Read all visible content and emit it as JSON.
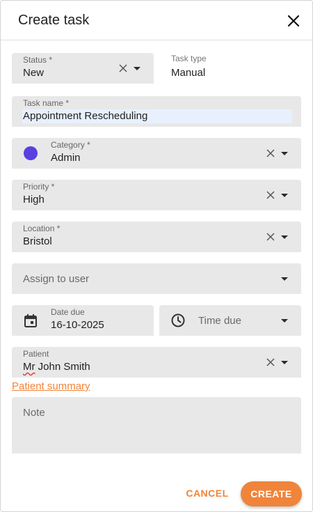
{
  "dialog": {
    "title": "Create task",
    "close_icon": "close-icon"
  },
  "status": {
    "label": "Status *",
    "value": "New"
  },
  "task_type": {
    "label": "Task type",
    "value": "Manual"
  },
  "task_name": {
    "label": "Task name *",
    "value": "Appointment Rescheduling"
  },
  "category": {
    "label": "Category *",
    "value": "Admin",
    "color": "#5b3fe0"
  },
  "priority": {
    "label": "Priority *",
    "value": "High"
  },
  "location": {
    "label": "Location *",
    "value": "Bristol"
  },
  "assign": {
    "placeholder": "Assign to user"
  },
  "date_due": {
    "label": "Date due",
    "value": "16-10-2025",
    "icon": "calendar-icon"
  },
  "time_due": {
    "placeholder": "Time due",
    "icon": "clock-icon"
  },
  "patient": {
    "label": "Patient",
    "title": "Mr",
    "name": "John Smith"
  },
  "patient_summary_link": "Patient summary",
  "note": {
    "placeholder": "Note"
  },
  "actions": {
    "cancel": "CANCEL",
    "create": "CREATE"
  },
  "colors": {
    "accent": "#f0843a",
    "field_bg": "#e8e8e8",
    "highlight": "#e8f0fe"
  }
}
